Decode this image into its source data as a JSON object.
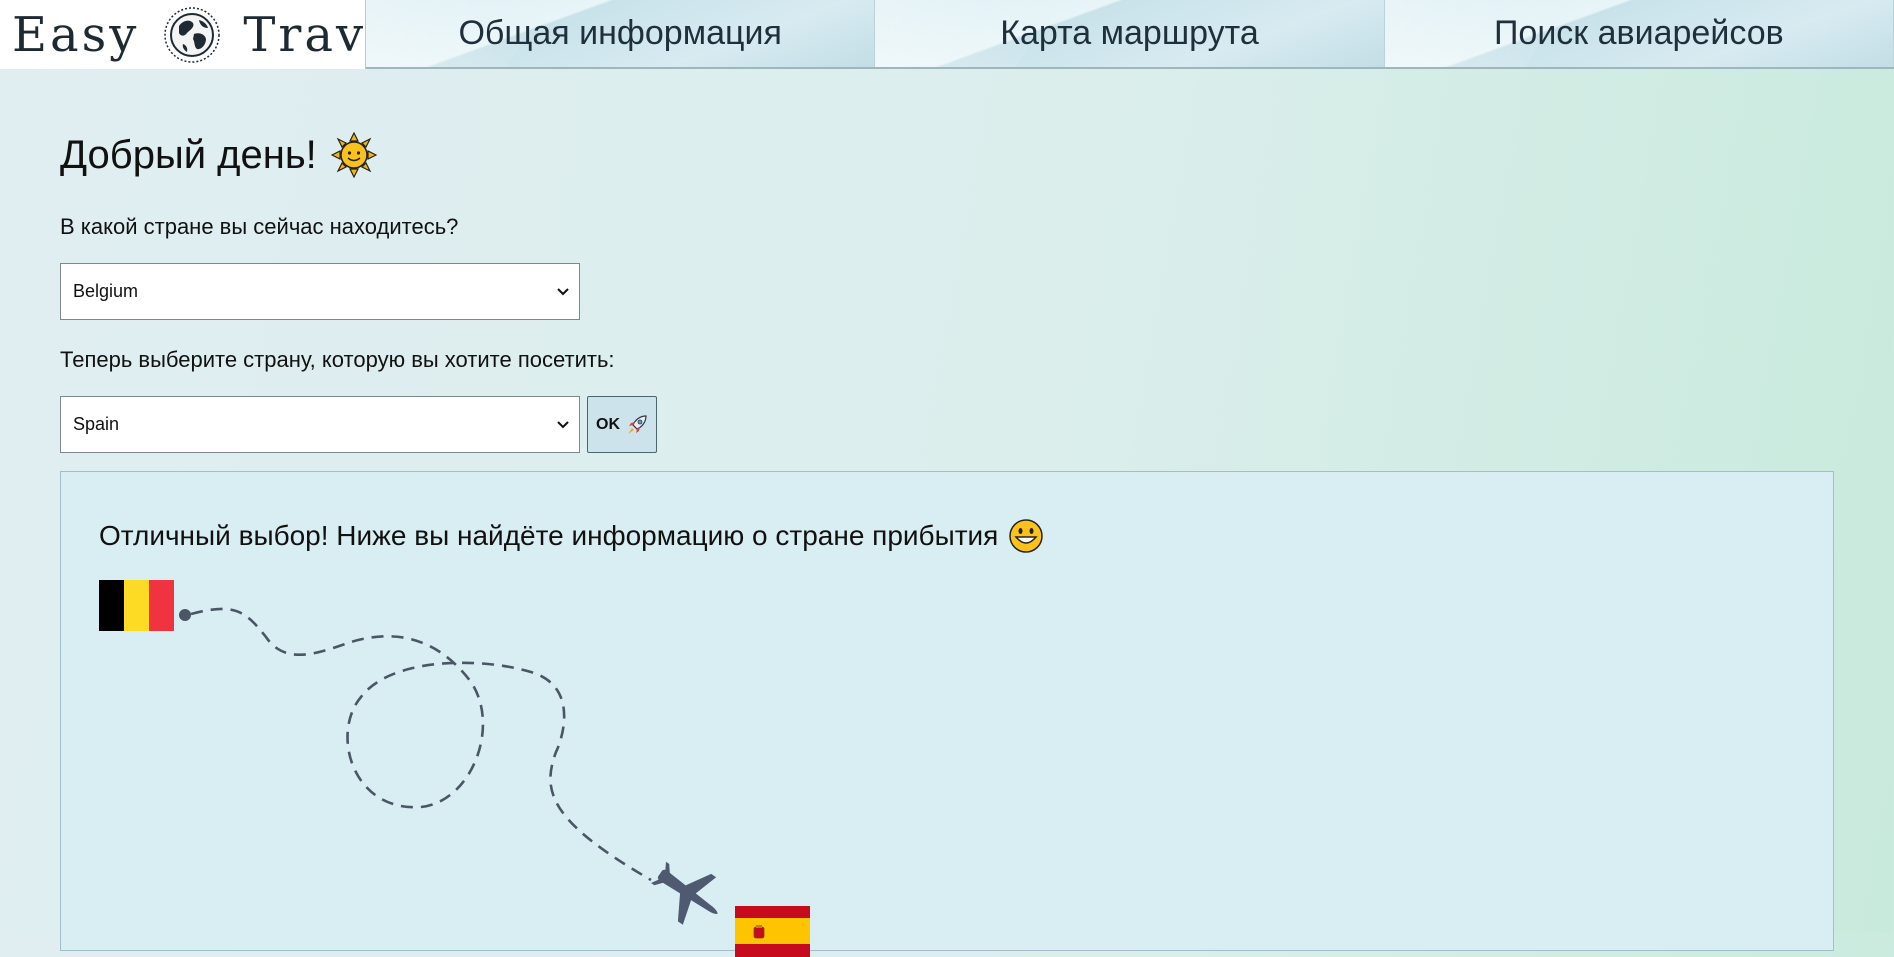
{
  "header": {
    "logo_left": "Easy",
    "logo_right": "Travel",
    "logo_icon": "globe-icon",
    "nav": [
      {
        "label": "Общая информация"
      },
      {
        "label": "Карта маршрута"
      },
      {
        "label": "Поиск авиарейсов"
      }
    ]
  },
  "main": {
    "greeting": "Добрый день!",
    "greeting_icon": "sun-emoji",
    "current_country_label": "В какой стране вы сейчас находитесь?",
    "current_country_value": "Belgium",
    "destination_label": "Теперь выберите страну, которую вы хотите посетить:",
    "destination_value": "Spain",
    "ok_label": "OK",
    "ok_icon": "rocket-icon"
  },
  "panel": {
    "title": "Отличный выбор! Ниже вы найдёте информацию о стране прибытия",
    "title_icon": "grinning-face-emoji",
    "origin_flag": "flag-belgium",
    "destination_flag": "flag-spain",
    "plane_icon": "airplane-icon"
  },
  "colors": {
    "flag_be": [
      "#000000",
      "#FDDA24",
      "#EF3340"
    ],
    "flag_es": [
      "#C60B1E",
      "#FFC400"
    ],
    "route": "#4a5566",
    "plane": "#4f5970"
  }
}
